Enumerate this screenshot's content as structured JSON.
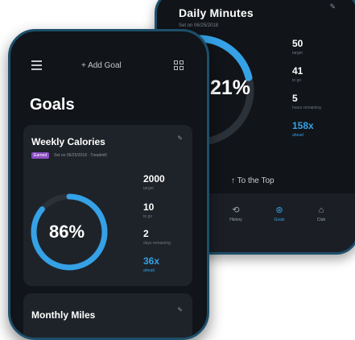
{
  "back_screen": {
    "title": "Daily Minutes",
    "set_on": "Set on 06/25/2018",
    "percent": "21%",
    "progress": 0.21,
    "stats": [
      {
        "value": "50",
        "label": "target"
      },
      {
        "value": "41",
        "label": "to go"
      },
      {
        "value": "5",
        "label": "hours remaining"
      },
      {
        "value": "158x",
        "label": "ahead"
      }
    ],
    "to_top": "To the Top",
    "nav": [
      {
        "icon": "history-icon",
        "label": "History"
      },
      {
        "icon": "goals-icon",
        "label": "Goals"
      },
      {
        "icon": "club-icon",
        "label": "Club"
      }
    ]
  },
  "front_screen": {
    "add_goal": "+ Add Goal",
    "title": "Goals",
    "cards": [
      {
        "title": "Weekly Calories",
        "badge": "Earned",
        "meta": "Set on 06/25/2018 · Treadmill",
        "percent": "86%",
        "progress": 0.86,
        "stats": [
          {
            "value": "2000",
            "label": "target"
          },
          {
            "value": "10",
            "label": "to go"
          },
          {
            "value": "2",
            "label": "days remaining"
          },
          {
            "value": "36x",
            "label": "ahead"
          }
        ]
      },
      {
        "title": "Monthly Miles"
      }
    ]
  },
  "colors": {
    "accent": "#35a1e6",
    "background": "#111418",
    "card": "#1e2329",
    "ring_track": "#2b3138",
    "badge": "#8b4fc4",
    "frame": "#1d4f6b"
  }
}
